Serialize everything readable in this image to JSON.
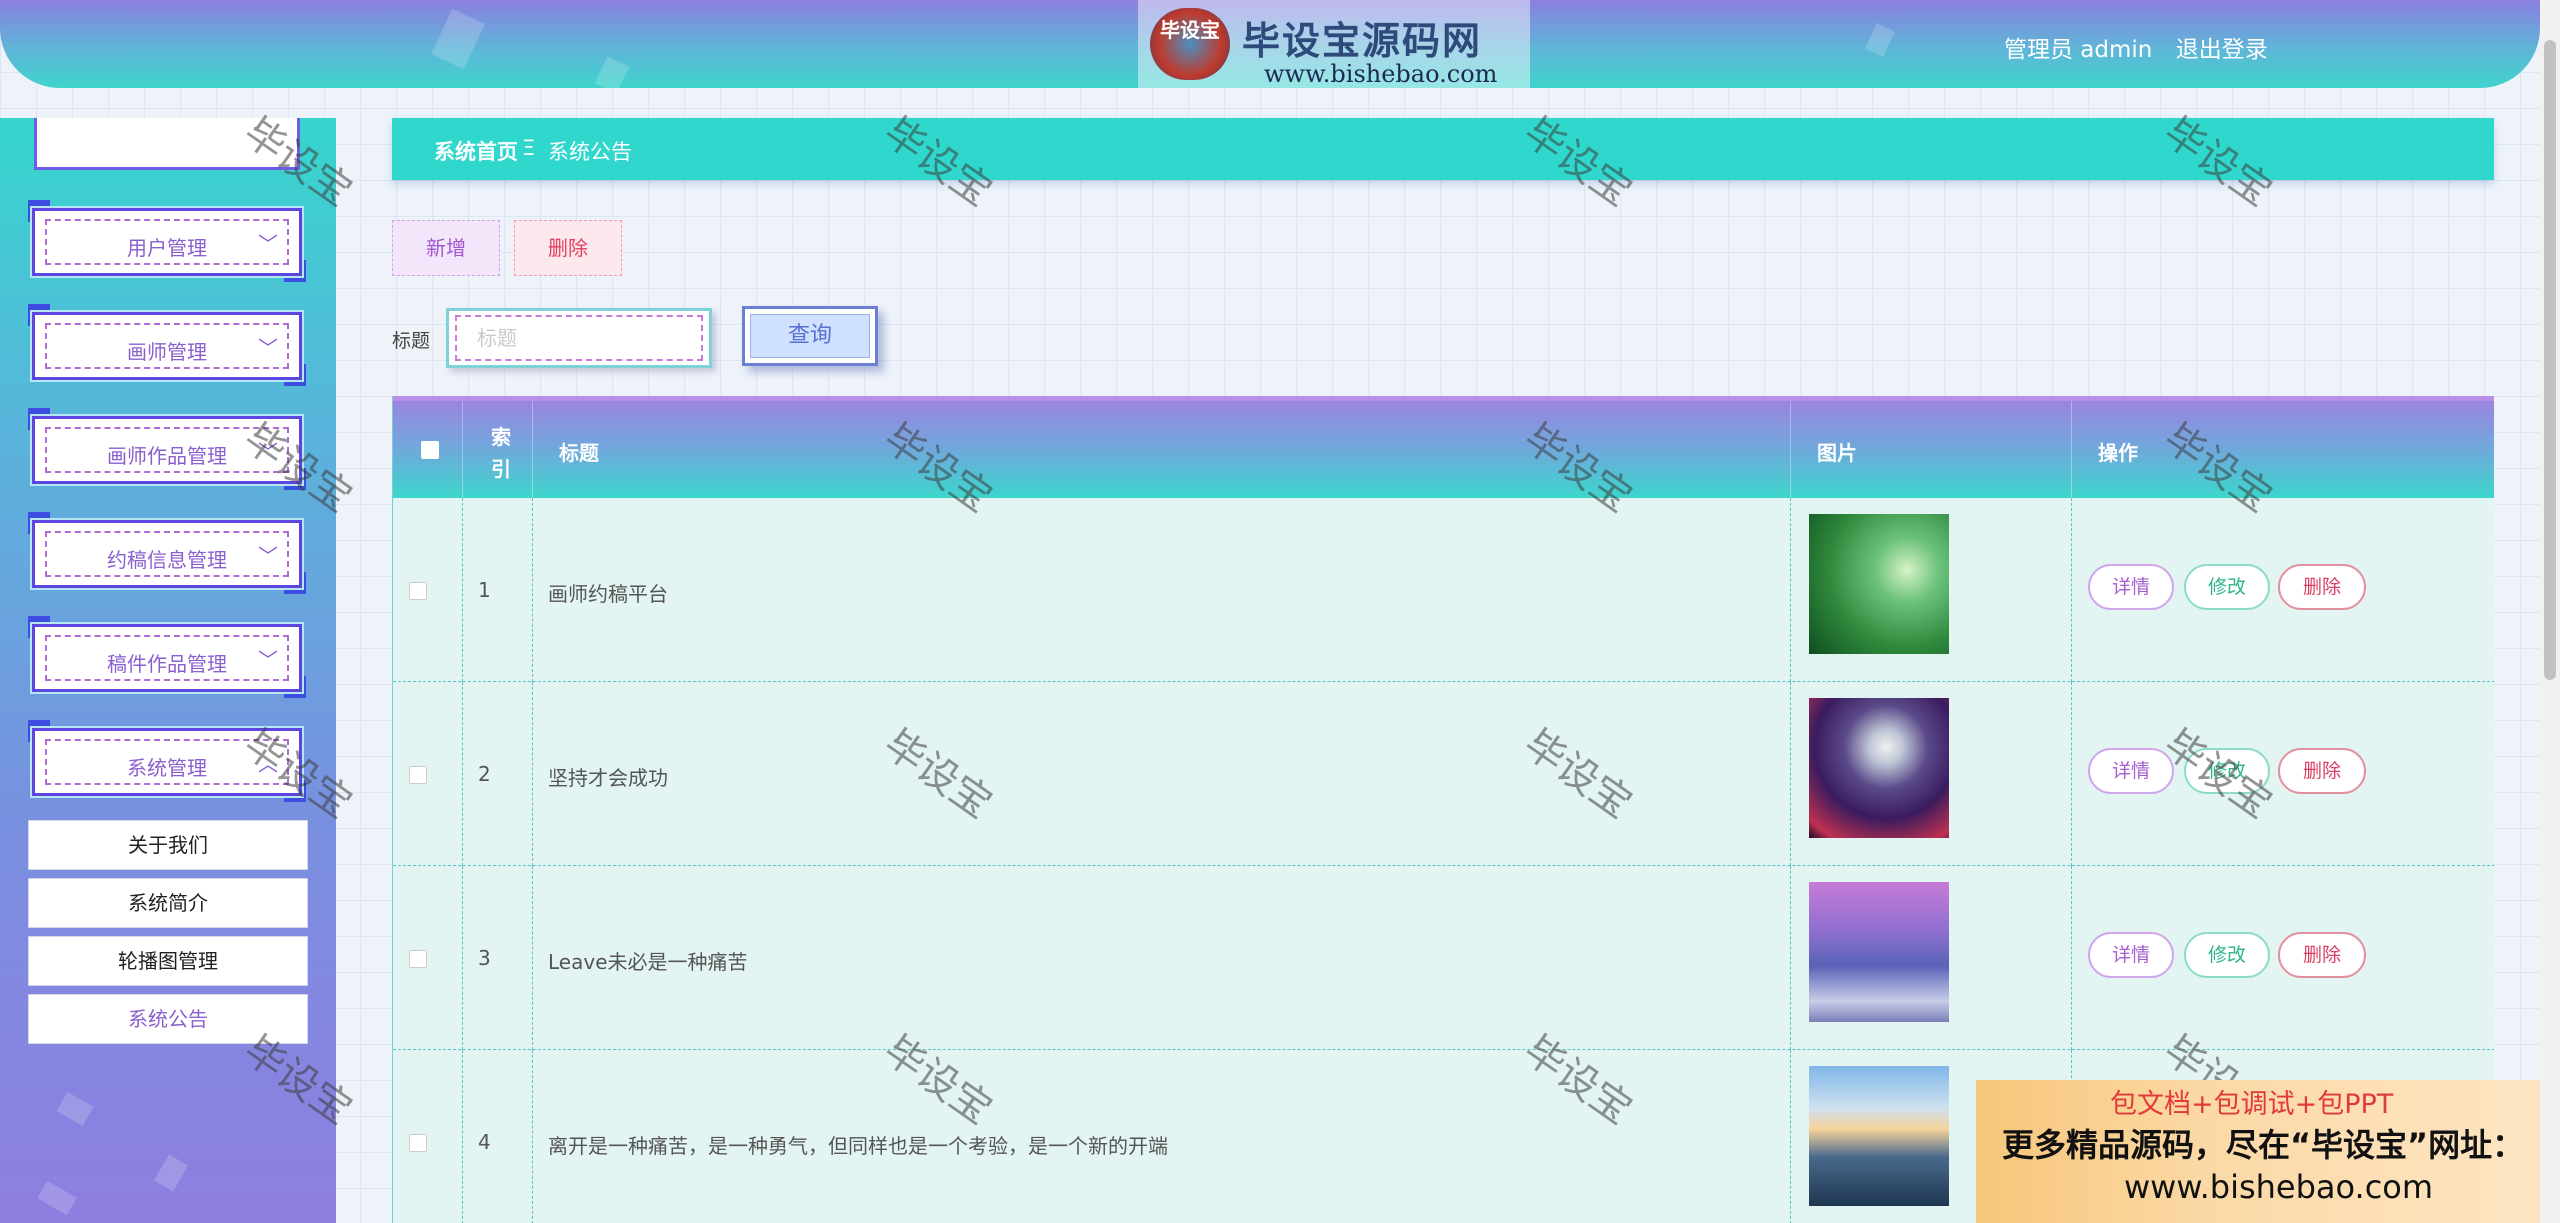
{
  "header": {
    "logo_badge": "毕设宝",
    "logo_title": "毕设宝源码网",
    "logo_url": "www.bishebao.com",
    "user_label": "管理员 admin",
    "logout_label": "退出登录"
  },
  "sidebar": {
    "menus": [
      {
        "label": "用户管理"
      },
      {
        "label": "画师管理"
      },
      {
        "label": "画师作品管理"
      },
      {
        "label": "约稿信息管理"
      },
      {
        "label": "稿件作品管理"
      },
      {
        "label": "系统管理"
      }
    ],
    "links": [
      {
        "label": "关于我们"
      },
      {
        "label": "系统简介"
      },
      {
        "label": "轮播图管理"
      },
      {
        "label": "系统公告"
      }
    ]
  },
  "breadcrumb": {
    "home": "系统首页",
    "separator": "Ξ",
    "current": "系统公告"
  },
  "actions": {
    "add_label": "新增",
    "delete_label": "删除"
  },
  "search": {
    "label": "标题",
    "placeholder": "标题",
    "button_label": "查询"
  },
  "table": {
    "columns": {
      "index": "索引",
      "title": "标题",
      "image": "图片",
      "ops": "操作"
    },
    "op_labels": {
      "detail": "详情",
      "edit": "修改",
      "delete": "删除"
    },
    "rows": [
      {
        "index": "1",
        "title": "画师约稿平台",
        "image": "green-abstract-image"
      },
      {
        "index": "2",
        "title": "坚持才会成功",
        "image": "moon-tree-image"
      },
      {
        "index": "3",
        "title": "Leave未必是一种痛苦",
        "image": "snowy-forest-image"
      },
      {
        "index": "4",
        "title": "离开是一种痛苦，是一种勇气，但同样也是一个考验，是一个新的开端",
        "image": "mountain-sunset-image"
      }
    ]
  },
  "watermark": "毕设宝",
  "ad": {
    "line1": "包文档+包调试+包PPT",
    "line2": "更多精品源码，尽在“毕设宝”网址：",
    "line3": "www.bishebao.com"
  },
  "colors": {
    "header_top": "#8b7fe0",
    "header_bottom": "#3fd4cc",
    "breadcrumb_bg": "#2fd7cc",
    "accent_purple": "#8a5fcf",
    "delete_red": "#d94060",
    "edit_green": "#2eb58e"
  }
}
